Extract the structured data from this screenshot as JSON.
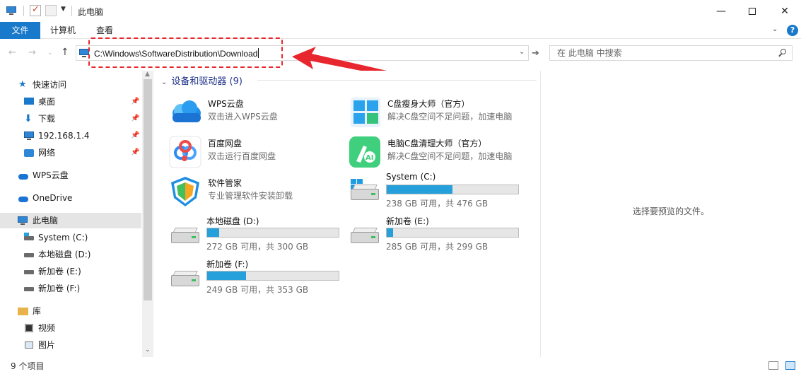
{
  "title": {
    "text": "此电脑"
  },
  "ribbon": {
    "tab_file": "文件",
    "tab_computer": "计算机",
    "tab_view": "查看"
  },
  "nav": {
    "address": "C:\\Windows\\SoftwareDistribution\\Download",
    "search_placeholder": "在 此电脑 中搜索"
  },
  "sidebar": {
    "quick_access": "快速访问",
    "items": [
      {
        "label": "桌面",
        "icon": "desktop-icon",
        "pinned": true
      },
      {
        "label": "下载",
        "icon": "download-icon",
        "pinned": true
      },
      {
        "label": "192.168.1.4",
        "icon": "monitor-icon",
        "pinned": true
      },
      {
        "label": "网络",
        "icon": "network-icon",
        "pinned": true
      }
    ],
    "wps": "WPS云盘",
    "onedrive": "OneDrive",
    "this_pc": "此电脑",
    "drives": [
      {
        "label": "System (C:)"
      },
      {
        "label": "本地磁盘 (D:)"
      },
      {
        "label": "新加卷 (E:)"
      },
      {
        "label": "新加卷 (F:)"
      }
    ],
    "library": "库",
    "library_items": [
      {
        "label": "视频"
      },
      {
        "label": "图片"
      }
    ]
  },
  "main": {
    "group_header": "设备和驱动器 (9)",
    "apps": [
      {
        "name": "WPS云盘",
        "desc": "双击进入WPS云盘"
      },
      {
        "name": "C盘瘦身大师（官方）",
        "desc": "解决C盘空间不足问题，加速电脑"
      },
      {
        "name": "百度网盘",
        "desc": "双击运行百度网盘"
      },
      {
        "name": "电脑C盘清理大师（官方）",
        "desc": "解决C盘空间不足问题，加速电脑"
      },
      {
        "name": "软件管家",
        "desc": "专业管理软件安装卸载"
      }
    ],
    "drives": [
      {
        "name": "System (C:)",
        "info": "238 GB 可用，共 476 GB",
        "used_fraction": 0.5
      },
      {
        "name": "本地磁盘 (D:)",
        "info": "272 GB 可用，共 300 GB",
        "used_fraction": 0.093
      },
      {
        "name": "新加卷 (E:)",
        "info": "285 GB 可用，共 299 GB",
        "used_fraction": 0.047
      },
      {
        "name": "新加卷 (F:)",
        "info": "249 GB 可用，共 353 GB",
        "used_fraction": 0.295
      }
    ]
  },
  "preview": {
    "text": "选择要预览的文件。"
  },
  "status": {
    "count": "9 个项目"
  },
  "colors": {
    "accent": "#1979ca",
    "drive_fill": "#26a0da",
    "annotation": "#e8262e"
  }
}
